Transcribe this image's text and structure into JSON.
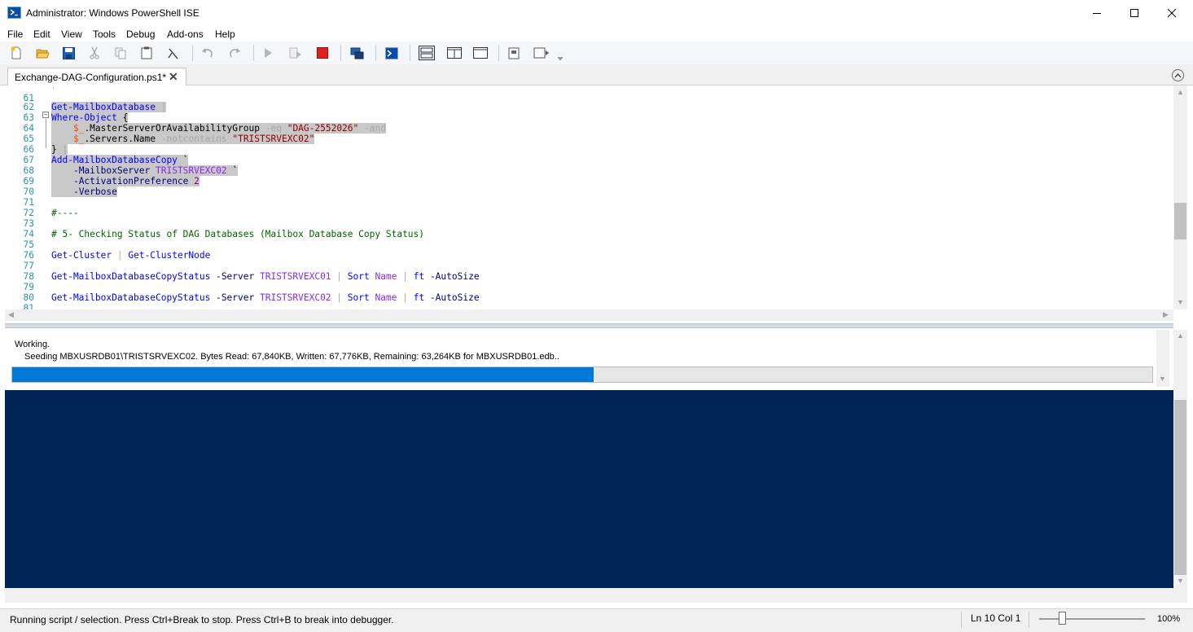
{
  "window": {
    "title": "Administrator: Windows PowerShell ISE"
  },
  "menu": [
    "File",
    "Edit",
    "View",
    "Tools",
    "Debug",
    "Add-ons",
    "Help"
  ],
  "toolbar_icons": [
    "new-script",
    "open",
    "save",
    "cut",
    "copy",
    "paste",
    "clear-console",
    "undo",
    "redo",
    "run-script",
    "run-selection",
    "stop",
    "new-remote-tab",
    "start-powershell",
    "show-script-pane-top",
    "show-script-pane-right",
    "show-script-pane-maximized",
    "show-command-window",
    "show-command-addon"
  ],
  "tab": {
    "label": "Exchange-DAG-Configuration.ps1*",
    "close": "✕"
  },
  "code_lines": [
    {
      "n": "61",
      "t": ""
    },
    {
      "n": "62",
      "t": "Get-MailboxDatabase |"
    },
    {
      "n": "63",
      "t": "Where-Object {"
    },
    {
      "n": "64",
      "t": "    $_.MasterServerOrAvailabilityGroup -eq \"DAG-2552026\" -and"
    },
    {
      "n": "65",
      "t": "    $_.Servers.Name -notcontains \"TRISTSRVEXC02\""
    },
    {
      "n": "66",
      "t": "} |"
    },
    {
      "n": "67",
      "t": "Add-MailboxDatabaseCopy `"
    },
    {
      "n": "68",
      "t": "    -MailboxServer TRISTSRVEXC02 `"
    },
    {
      "n": "69",
      "t": "    -ActivationPreference 2"
    },
    {
      "n": "70",
      "t": "    -Verbose"
    },
    {
      "n": "71",
      "t": ""
    },
    {
      "n": "72",
      "t": "#----"
    },
    {
      "n": "73",
      "t": ""
    },
    {
      "n": "74",
      "t": "# 5- Checking Status of DAG Databases (Mailbox Database Copy Status)"
    },
    {
      "n": "75",
      "t": ""
    },
    {
      "n": "76",
      "t": "Get-Cluster | Get-ClusterNode"
    },
    {
      "n": "77",
      "t": ""
    },
    {
      "n": "78",
      "t": "Get-MailboxDatabaseCopyStatus -Server TRISTSRVEXC01 | Sort Name | ft -AutoSize"
    },
    {
      "n": "79",
      "t": ""
    },
    {
      "n": "80",
      "t": "Get-MailboxDatabaseCopyStatus -Server TRISTSRVEXC02 | Sort Name | ft -AutoSize"
    },
    {
      "n": "81",
      "t": ""
    }
  ],
  "console": {
    "working": "Working.",
    "seeding": "Seeding MBXUSRDB01\\TRISTSRVEXC02. Bytes Read: 67,840KB, Written: 67,776KB, Remaining: 63,264KB for MBXUSRDB01.edb..",
    "progress_fraction": 0.51
  },
  "status": {
    "text": "Running script / selection.  Press Ctrl+Break to stop.  Press Ctrl+B to break into debugger.",
    "ln_col": "Ln 10  Col 1",
    "zoom": "100%"
  },
  "colors": {
    "console_bg": "#012456",
    "progress": "#0078d7",
    "selection": "#c8c8c8"
  }
}
